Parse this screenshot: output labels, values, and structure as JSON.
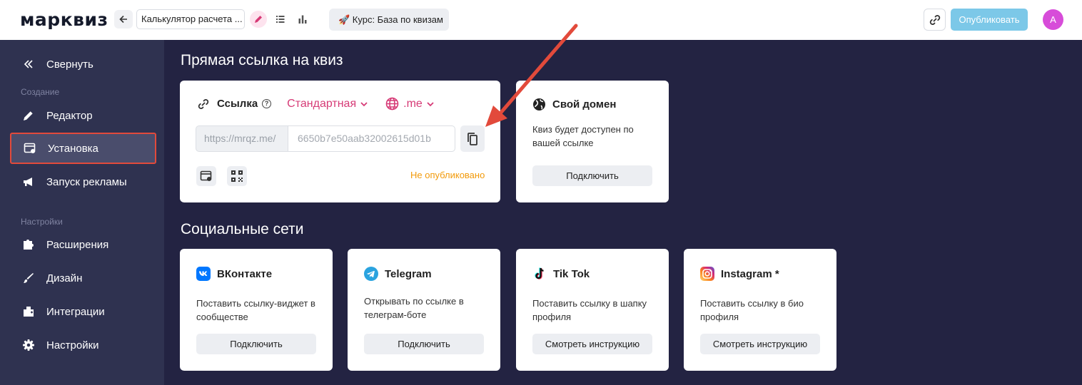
{
  "topbar": {
    "logo": "марквиз",
    "quiz_name": "Калькулятор расчета ...",
    "course_label": "🚀 Курс: База по квизам",
    "publish_label": "Опубликовать",
    "avatar_letter": "A"
  },
  "sidebar": {
    "collapse_label": "Свернуть",
    "section_create": "Создание",
    "section_settings": "Настройки",
    "items": [
      {
        "label": "Редактор",
        "icon": "pencil-icon"
      },
      {
        "label": "Установка",
        "icon": "install-window-icon",
        "active": true
      },
      {
        "label": "Запуск рекламы",
        "icon": "megaphone-icon"
      },
      {
        "label": "Расширения",
        "icon": "extension-icon"
      },
      {
        "label": "Дизайн",
        "icon": "brush-icon"
      },
      {
        "label": "Интеграции",
        "icon": "integrations-icon"
      },
      {
        "label": "Настройки",
        "icon": "gear-icon"
      }
    ]
  },
  "main": {
    "direct_link_title": "Прямая ссылка на квиз",
    "link_card": {
      "title": "Ссылка",
      "help": "?",
      "type_select": "Стандартная",
      "domain_select": ".me",
      "url_prefix": "https://mrqz.me/",
      "url_value": "6650b7e50aab32002615d01b",
      "status": "Не опубликовано"
    },
    "domain_card": {
      "title": "Свой домен",
      "desc": "Квиз будет доступен по вашей ссылке",
      "button": "Подключить"
    },
    "social_title": "Социальные сети",
    "social": [
      {
        "title": "ВКонтакте",
        "desc": "Поставить ссылку-виджет в сообществе",
        "button": "Подключить"
      },
      {
        "title": "Telegram",
        "desc": "Открывать по ссылке в телеграм-боте",
        "button": "Подключить"
      },
      {
        "title": "Tik Tok",
        "desc": "Поставить ссылку в шапку профиля",
        "button": "Смотреть инструкцию"
      },
      {
        "title": "Instagram *",
        "desc": "Поставить ссылку в био профиля",
        "button": "Смотреть инструкцию"
      }
    ]
  },
  "colors": {
    "accent_pink": "#d63a76",
    "status_orange": "#f29a0a",
    "annotation_red": "#e24a3b",
    "sidebar_bg": "#2f3250",
    "main_bg": "#232342"
  }
}
